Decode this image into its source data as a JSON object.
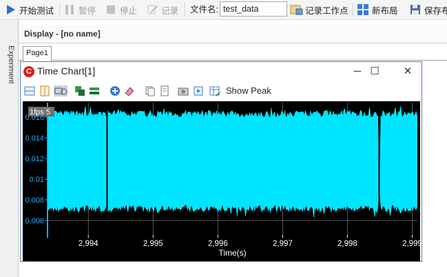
{
  "toolbar": {
    "start_label": "开始测试",
    "pause_label": "暂停",
    "stop_label": "停止",
    "record_label": "记录",
    "filename_label": "文件名:",
    "filename_value": "test_data",
    "record_workpoint_label": "记录工作点",
    "new_layout_label": "新布局",
    "save_label": "保存布"
  },
  "sidebar": {
    "label": "Experiment"
  },
  "display": {
    "title": "Display - [no name]",
    "tab_label": "Page1"
  },
  "window": {
    "logo": "C",
    "title": "Time Chart[1]",
    "minimize_glyph": "─",
    "maximize_glyph": "☐",
    "close_glyph": "✕"
  },
  "chart_toolbar": {
    "show_peak_label": "Show Peak"
  },
  "chart_data": {
    "type": "line",
    "fps_label": "1fps 5",
    "xlabel": "Time(s)",
    "ylabel": "",
    "x_range": [
      2993.37,
      2999.08
    ],
    "y_range": [
      0.0046,
      0.0174
    ],
    "x_ticks": [
      2994,
      2995,
      2996,
      2997,
      2998,
      2999
    ],
    "x_tick_labels": [
      "2,994",
      "2,995",
      "2,996",
      "2,997",
      "2,998",
      "2,999"
    ],
    "y_ticks": [
      0.006,
      0.008,
      0.01,
      0.012,
      0.014,
      0.016
    ],
    "y_tick_labels": [
      "0.006",
      "0.008",
      "0.01",
      "0.012",
      "0.014",
      "0.016"
    ],
    "series": [
      {
        "color": "#00e5ff",
        "band_upper": 0.0163,
        "band_lower": 0.0072,
        "peak_upper": 0.0168,
        "peak_lower": 0.0066,
        "gaps_x": [
          2994.29,
          2998.49
        ]
      }
    ],
    "background": "#000000",
    "grid": true
  },
  "colors": {
    "accent": "#4a7fc1",
    "plot_bg": "#000000",
    "signal": "#00e5ff",
    "axis_text": "#ffffff",
    "blue_axis": "#2aa9ff"
  }
}
